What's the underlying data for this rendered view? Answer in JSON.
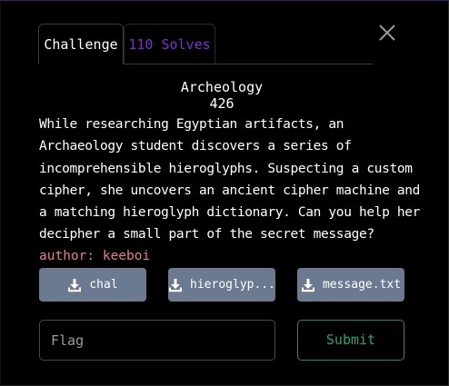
{
  "tabs": {
    "challenge": "Challenge",
    "solves": "110 Solves"
  },
  "challenge": {
    "name": "Archeology",
    "value": "426",
    "description": "While researching Egyptian artifacts, an Archaeology student discovers a series of incomprehensible hieroglyphs. Suspecting a custom cipher, she uncovers an ancient cipher machine and a matching hieroglyph dictionary. Can you help her decipher a small part of the secret message?",
    "author": "author: keeboi"
  },
  "files": [
    {
      "label": "chal",
      "icon": "download-icon"
    },
    {
      "label": "hieroglyp...",
      "icon": "download-icon"
    },
    {
      "label": "message.txt",
      "icon": "download-icon"
    }
  ],
  "submission": {
    "flag_placeholder": "Flag",
    "flag_value": "",
    "submit_label": "Submit"
  },
  "colors": {
    "accent_purple": "#7b2fd0",
    "author_pink": "#e87a9a",
    "file_button": "#6c7a91",
    "submit_green": "#22a37f"
  },
  "icons": {
    "close": "close-icon"
  }
}
